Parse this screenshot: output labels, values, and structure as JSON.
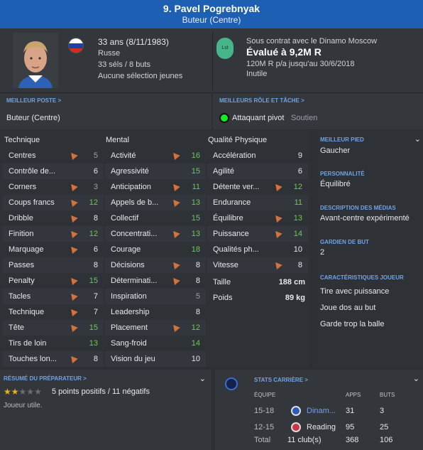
{
  "header": {
    "name": "9. Pavel Pogrebnyak",
    "role": "Buteur (Centre)"
  },
  "player": {
    "age_dob": "33 ans (8/11/1983)",
    "nationality": "Russe",
    "caps": "33 séls / 8 buts",
    "youth": "Aucune sélection jeunes"
  },
  "contract": {
    "club": "Sous contrat avec le Dinamo Moscow",
    "value": "Évalué à 9,2M R",
    "wage": "120M R p/a jusqu'au 30/6/2018",
    "status": "Inutile",
    "badge": "Lst"
  },
  "best_position": {
    "label": "MEILLEUR POSTE >",
    "value": "Buteur (Centre)"
  },
  "best_role": {
    "label": "MEILLEURS RÔLE ET TÂCHE >",
    "value": "Attaquant pivot",
    "duty": "Soutien"
  },
  "technique": {
    "title": "Technique",
    "rows": [
      {
        "k": "Centres",
        "v": "5",
        "c": "d",
        "arrow": true
      },
      {
        "k": "Contrôle de...",
        "v": "6",
        "c": "n",
        "arrow": false
      },
      {
        "k": "Corners",
        "v": "3",
        "c": "d",
        "arrow": true
      },
      {
        "k": "Coups francs",
        "v": "12",
        "c": "g",
        "arrow": true
      },
      {
        "k": "Dribble",
        "v": "8",
        "c": "n",
        "arrow": true
      },
      {
        "k": "Finition",
        "v": "12",
        "c": "g",
        "arrow": true
      },
      {
        "k": "Marquage",
        "v": "6",
        "c": "n",
        "arrow": true
      },
      {
        "k": "Passes",
        "v": "8",
        "c": "n",
        "arrow": false
      },
      {
        "k": "Penalty",
        "v": "15",
        "c": "g",
        "arrow": true
      },
      {
        "k": "Tacles",
        "v": "7",
        "c": "n",
        "arrow": true
      },
      {
        "k": "Technique",
        "v": "7",
        "c": "n",
        "arrow": true
      },
      {
        "k": "Tête",
        "v": "15",
        "c": "g",
        "arrow": true
      },
      {
        "k": "Tirs de loin",
        "v": "13",
        "c": "g",
        "arrow": false
      },
      {
        "k": "Touches lon...",
        "v": "8",
        "c": "n",
        "arrow": true
      }
    ]
  },
  "mental": {
    "title": "Mental",
    "rows": [
      {
        "k": "Activité",
        "v": "16",
        "c": "g",
        "arrow": true
      },
      {
        "k": "Agressivité",
        "v": "15",
        "c": "g",
        "arrow": false
      },
      {
        "k": "Anticipation",
        "v": "11",
        "c": "g",
        "arrow": true
      },
      {
        "k": "Appels de b...",
        "v": "13",
        "c": "g",
        "arrow": true
      },
      {
        "k": "Collectif",
        "v": "15",
        "c": "g",
        "arrow": false
      },
      {
        "k": "Concentrati...",
        "v": "13",
        "c": "g",
        "arrow": true
      },
      {
        "k": "Courage",
        "v": "18",
        "c": "g",
        "arrow": false
      },
      {
        "k": "Décisions",
        "v": "8",
        "c": "n",
        "arrow": true
      },
      {
        "k": "Déterminati...",
        "v": "8",
        "c": "n",
        "arrow": true
      },
      {
        "k": "Inspiration",
        "v": "5",
        "c": "d",
        "arrow": false
      },
      {
        "k": "Leadership",
        "v": "8",
        "c": "n",
        "arrow": false
      },
      {
        "k": "Placement",
        "v": "12",
        "c": "g",
        "arrow": true
      },
      {
        "k": "Sang-froid",
        "v": "14",
        "c": "g",
        "arrow": false
      },
      {
        "k": "Vision du jeu",
        "v": "10",
        "c": "n",
        "arrow": false
      }
    ]
  },
  "physical": {
    "title": "Qualité Physique",
    "rows": [
      {
        "k": "Accélération",
        "v": "9",
        "c": "n",
        "arrow": false
      },
      {
        "k": "Agilité",
        "v": "6",
        "c": "n",
        "arrow": false
      },
      {
        "k": "Détente ver...",
        "v": "12",
        "c": "g",
        "arrow": true
      },
      {
        "k": "Endurance",
        "v": "11",
        "c": "g",
        "arrow": false
      },
      {
        "k": "Équilibre",
        "v": "13",
        "c": "g",
        "arrow": true
      },
      {
        "k": "Puissance",
        "v": "14",
        "c": "g",
        "arrow": true
      },
      {
        "k": "Qualités ph...",
        "v": "10",
        "c": "n",
        "arrow": false
      },
      {
        "k": "Vitesse",
        "v": "8",
        "c": "n",
        "arrow": true
      }
    ],
    "height_label": "Taille",
    "height": "188 cm",
    "weight_label": "Poids",
    "weight": "89 kg"
  },
  "side": {
    "foot_label": "MEILLEUR PIED",
    "foot": "Gaucher",
    "pers_label": "PERSONNALITÉ",
    "pers": "Équilibré",
    "media_label": "DESCRIPTION DES MÉDIAS",
    "media": "Avant-centre expérimenté",
    "gk_label": "GARDIEN DE BUT",
    "gk": "2",
    "traits_label": "CARACTÉRISTIQUES JOUEUR",
    "traits": [
      "Tire avec puissance",
      "Joue dos au but",
      "Garde trop la balle"
    ]
  },
  "coach": {
    "label": "RÉSUMÉ DU PRÉPARATEUR >",
    "stars_filled": 2,
    "stars_total": 5,
    "summary": "5 points positifs / 11 négatifs",
    "note": "Joueur utile."
  },
  "career": {
    "label": "STATS CARRIÈRE >",
    "h_team": "ÉQUIPE",
    "h_apps": "APPS",
    "h_goals": "BUTS",
    "rows": [
      {
        "season": "15-18",
        "team": "Dinam...",
        "apps": "31",
        "goals": "3"
      },
      {
        "season": "12-15",
        "team": "Reading",
        "apps": "95",
        "goals": "25"
      },
      {
        "season": "Total",
        "team": "11 club(s)",
        "apps": "368",
        "goals": "106"
      }
    ]
  },
  "colors": {
    "header": "#1c5fb3",
    "good": "#6dcc54",
    "label": "#6fa3e6",
    "arrow": "#d5713a"
  }
}
